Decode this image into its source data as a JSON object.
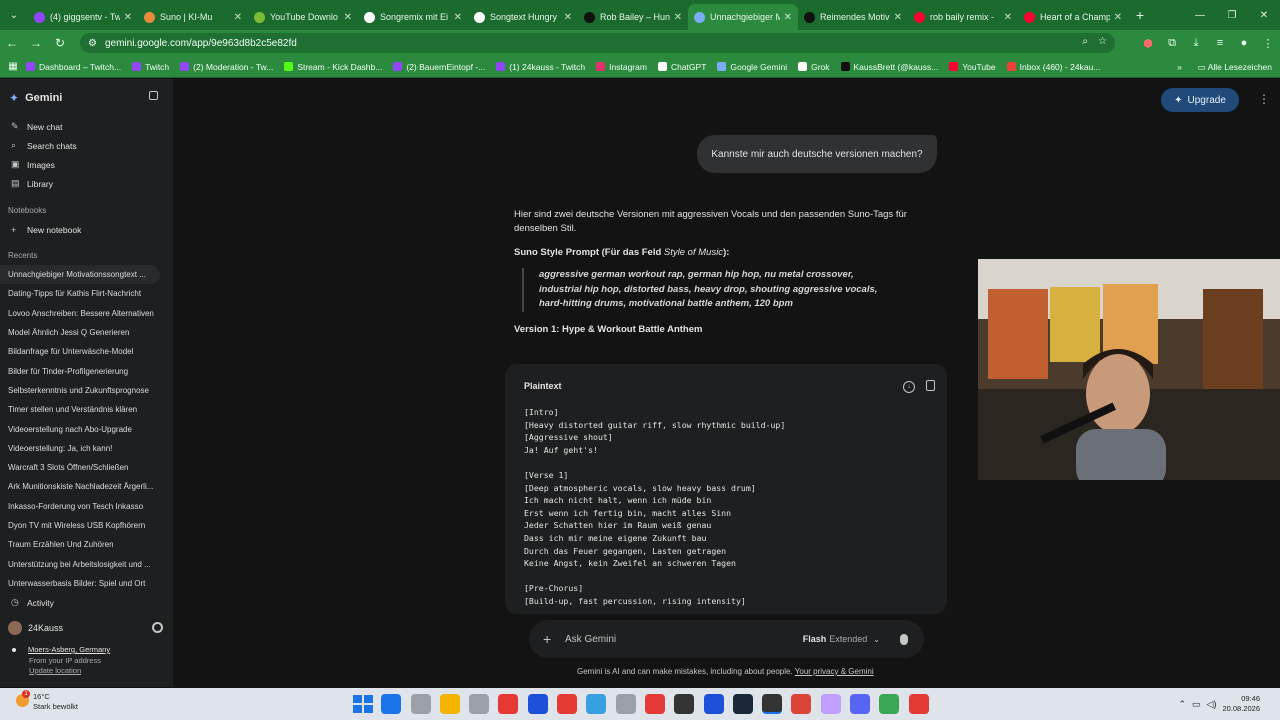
{
  "browser": {
    "tabs": [
      {
        "title": "(4) giggsentv - Tw",
        "color": "#9146ff"
      },
      {
        "title": "Suno | KI-Mu",
        "color": "#ea8a3a"
      },
      {
        "title": "YouTube Downlo",
        "color": "#7dbb35"
      },
      {
        "title": "Songremix mit Ei",
        "color": "#ffffff"
      },
      {
        "title": "Songtext Hungry",
        "color": "#ffffff"
      },
      {
        "title": "Rob Bailey – Hung",
        "color": "#111111"
      },
      {
        "title": "Unnachgiebiger M",
        "color": "#7cacf8"
      },
      {
        "title": "Reimendes Motiv",
        "color": "#111111"
      },
      {
        "title": "rob baily remix -",
        "color": "#ff0033"
      },
      {
        "title": "Heart of a Champ",
        "color": "#ff0033"
      }
    ],
    "active_tab": 6,
    "url": "gemini.google.com/app/9e963d8b2c5e82fd",
    "bookmarks": [
      {
        "label": "Dashboard – Twitch...",
        "color": "#9146ff"
      },
      {
        "label": "Twitch",
        "color": "#9146ff"
      },
      {
        "label": "(2) Moderation - Tw...",
        "color": "#9146ff"
      },
      {
        "label": "Stream - Kick Dashb...",
        "color": "#53fc18"
      },
      {
        "label": "(2) BauernEintopf -...",
        "color": "#9146ff"
      },
      {
        "label": "(1) 24kauss - Twitch",
        "color": "#9146ff"
      },
      {
        "label": "Instagram",
        "color": "#e1306c"
      },
      {
        "label": "ChatGPT",
        "color": "#ffffff"
      },
      {
        "label": "Google Gemini",
        "color": "#7cacf8"
      },
      {
        "label": "Grok",
        "color": "#ffffff"
      },
      {
        "label": "KaussBrett (@kauss...",
        "color": "#111111"
      },
      {
        "label": "YouTube",
        "color": "#ff0033"
      },
      {
        "label": "Inbox (460) - 24kau...",
        "color": "#ea4335"
      }
    ],
    "all_bookmarks_label": "Alle Lesezeichen"
  },
  "sidebar": {
    "app_name": "Gemini",
    "new_chat": "New chat",
    "search_chats": "Search chats",
    "images": "Images",
    "library": "Library",
    "notebooks_heading": "Notebooks",
    "new_notebook": "New notebook",
    "recents_heading": "Recents",
    "recents": [
      "Unnachgiebiger Motivationssongtext ...",
      "Dating-Tipps für Kathis Flirt-Nachricht",
      "Lovoo Anschreiben: Bessere Alternativen",
      "Model Ähnlich Jessi Q Generieren",
      "Bildanfrage für Unterwäsche-Model",
      "Bilder für Tinder-Profilgenerierung",
      "Selbsterkenntnis und Zukunftsprognose",
      "Timer stellen und Verständnis klären",
      "Videoerstellung nach Abo-Upgrade",
      "Videoerstellung: Ja, ich kann!",
      "Warcraft 3 Slots Öffnen/Schließen",
      "Ark Munitionskiste Nachladezeit Ärgerli...",
      "Inkasso-Forderung von Tesch Inkasso",
      "Dyon TV mit Wireless USB Kopfhörern",
      "Traum Erzählen Und Zuhören",
      "Unterstützung bei Arbeitslosigkeit und ...",
      "Unterwasserbasis Bilder: Spiel und Ort"
    ],
    "activity": "Activity",
    "username": "24Kauss",
    "location": "Moers-Asberg, Germany",
    "location_source": "From your IP address",
    "update_location": "Update location"
  },
  "main": {
    "upgrade": "Upgrade",
    "user_message": "Kannste mir auch deutsche versionen machen?",
    "response_intro": "Hier sind zwei deutsche Versionen mit aggressiven Vocals und den passenden Suno-Tags für denselben Stil.",
    "style_prompt_label": "Suno Style Prompt",
    "style_prompt_hint_pre": " (Für das Feld ",
    "style_prompt_hint_em": "Style of Music",
    "style_prompt_hint_post": "):",
    "style_prompt": "aggressive german workout rap, german hip hop, nu metal crossover, industrial hip hop, distorted bass, heavy drop, shouting aggressive vocals, hard-hitting drums, motivational battle anthem, 120 bpm",
    "version1_heading": "Version 1: Hype & Workout Battle Anthem",
    "code_label": "Plaintext",
    "code_lines": [
      "[Intro]",
      "[Heavy distorted guitar riff, slow rhythmic build-up]",
      "[Aggressive shout]",
      "Ja! Auf geht's!",
      "",
      "[Verse 1]",
      "[Deep atmospheric vocals, slow heavy bass drum]",
      "Ich mach nicht halt, wenn ich müde bin",
      "Erst wenn ich fertig bin, macht alles Sinn",
      "Jeder Schatten hier im Raum weiß genau",
      "Dass ich mir meine eigene Zukunft bau",
      "Durch das Feuer gegangen, Lasten getragen",
      "Keine Angst, kein Zweifel an schweren Tagen",
      "",
      "[Pre-Chorus]",
      "[Build-up, fast percussion, rising intensity]"
    ],
    "input_placeholder": "Ask Gemini",
    "mode_label": "Flash",
    "mode_sub": "Extended",
    "disclaimer_pre": "Gemini is AI and can make mistakes, including about people. ",
    "disclaimer_link": "Your privacy & Gemini"
  },
  "taskbar": {
    "temperature": "16°C",
    "weather": "Stark bewölkt",
    "weather_badge": "1",
    "time": "09:46",
    "date": "20.08.2026",
    "apps": [
      "#1a73e8",
      "#9aa0a6",
      "#f4b400",
      "#9aa0a6",
      "#e53935",
      "#1e4fd8",
      "#e53935",
      "#37a0e0",
      "#9aa0a6",
      "#e53935",
      "#333333",
      "#1e4fd8",
      "#1b2838",
      "#333333",
      "#db4437",
      "#c0a0ff",
      "#5865f2",
      "#3aa757",
      "#e53935"
    ]
  }
}
